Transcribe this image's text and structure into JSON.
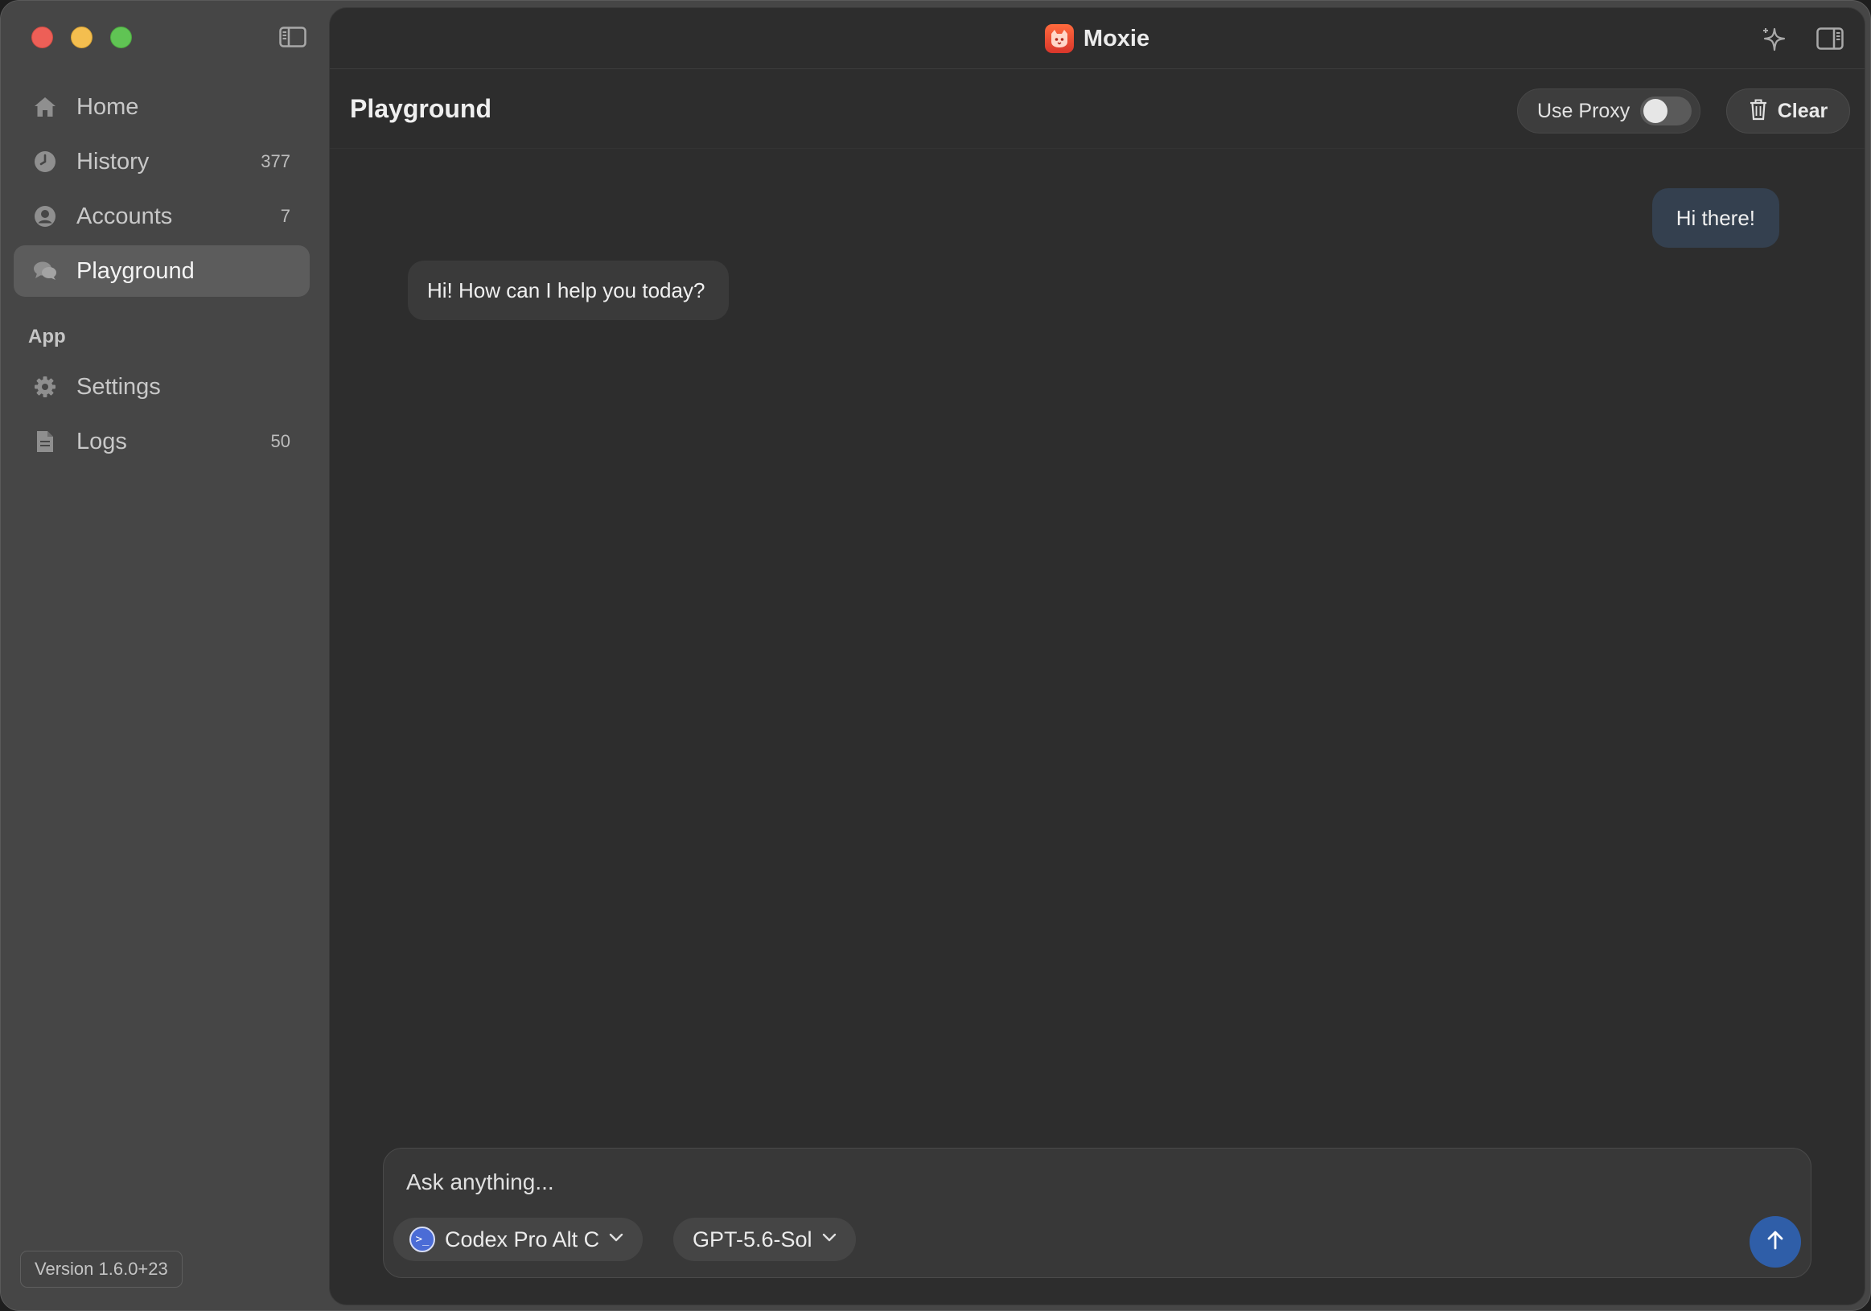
{
  "window": {
    "traffic_lights": [
      "close",
      "minimize",
      "zoom"
    ],
    "title": "Moxie"
  },
  "sidebar": {
    "items": [
      {
        "label": "Home",
        "icon": "home-icon",
        "count": ""
      },
      {
        "label": "History",
        "icon": "clock-icon",
        "count": "377"
      },
      {
        "label": "Accounts",
        "icon": "user-circle-icon",
        "count": "7"
      },
      {
        "label": "Playground",
        "icon": "chat-bubbles-icon",
        "count": "",
        "active": true
      }
    ],
    "section_label": "App",
    "app_items": [
      {
        "label": "Settings",
        "icon": "gear-icon",
        "count": ""
      },
      {
        "label": "Logs",
        "icon": "document-icon",
        "count": "50"
      }
    ],
    "version": "Version 1.6.0+23"
  },
  "header": {
    "page_title": "Playground",
    "proxy_label": "Use Proxy",
    "proxy_enabled": false,
    "clear_label": "Clear"
  },
  "messages": [
    {
      "role": "user",
      "text": "Hi there!"
    },
    {
      "role": "assistant",
      "text": "Hi! How can I help you today?"
    }
  ],
  "composer": {
    "placeholder": "Ask anything...",
    "value": "",
    "account": "Codex Pro Alt C",
    "model": "GPT-5.6-Sol"
  },
  "colors": {
    "sidebar_bg": "#464646",
    "main_bg": "#2d2d2d",
    "user_bubble": "#34404f",
    "assistant_bubble": "#3a3a3a",
    "send_button": "#2f5ea8",
    "brand": "#e8482f"
  }
}
